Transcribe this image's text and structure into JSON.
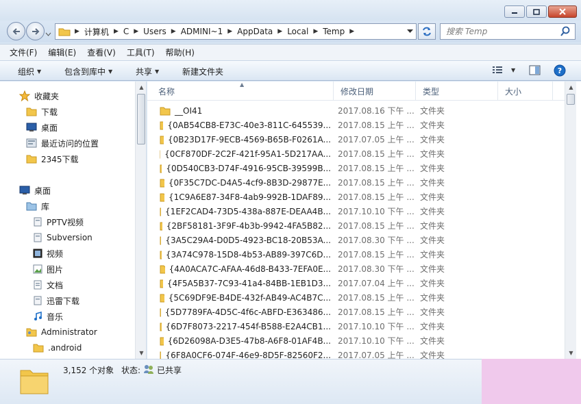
{
  "window": {
    "buttons": [
      "minimize",
      "maximize",
      "close"
    ]
  },
  "address_bar": {
    "crumbs": [
      "计算机",
      "C",
      "Users",
      "ADMINI~1",
      "AppData",
      "Local",
      "Temp"
    ]
  },
  "search": {
    "placeholder": "搜索 Temp"
  },
  "menu": [
    "文件(F)",
    "编辑(E)",
    "查看(V)",
    "工具(T)",
    "帮助(H)"
  ],
  "toolbar": {
    "organize": "组织",
    "include_library": "包含到库中",
    "share": "共享",
    "new_folder": "新建文件夹"
  },
  "nav": {
    "favorites": "收藏夹",
    "fav_items": [
      "下载",
      "桌面",
      "最近访问的位置",
      "2345下载"
    ],
    "desktop": "桌面",
    "library": "库",
    "lib_items": [
      "PPTV视频",
      "Subversion",
      "视频",
      "图片",
      "文档",
      "迅雷下载",
      "音乐"
    ],
    "administrator": "Administrator",
    "android": ".android"
  },
  "columns": {
    "name": "名称",
    "date": "修改日期",
    "type": "类型",
    "size": "大小"
  },
  "files": [
    {
      "name": "__OI41",
      "date": "2017.08.16 下午 ...",
      "type": "文件夹"
    },
    {
      "name": "{0AB54CB8-E73C-40e3-811C-645539...",
      "date": "2017.08.15 上午 ...",
      "type": "文件夹"
    },
    {
      "name": "{0B23D17F-9ECB-4569-B65B-F0261A...",
      "date": "2017.07.05 上午 ...",
      "type": "文件夹"
    },
    {
      "name": "{0CF870DF-2C2F-421f-95A1-5D217AA...",
      "date": "2017.08.15 上午 ...",
      "type": "文件夹"
    },
    {
      "name": "{0D540CB3-D74F-4916-95CB-39599B...",
      "date": "2017.08.15 上午 ...",
      "type": "文件夹"
    },
    {
      "name": "{0F35C7DC-D4A5-4cf9-8B3D-29877E...",
      "date": "2017.08.15 上午 ...",
      "type": "文件夹"
    },
    {
      "name": "{1C9A6E87-34F8-4ab9-992B-1DAF89...",
      "date": "2017.08.15 上午 ...",
      "type": "文件夹"
    },
    {
      "name": "{1EF2CAD4-73D5-438a-887E-DEAA4B...",
      "date": "2017.10.10 下午 ...",
      "type": "文件夹"
    },
    {
      "name": "{2BF58181-3F9F-4b3b-9942-4FA5B82...",
      "date": "2017.08.15 上午 ...",
      "type": "文件夹"
    },
    {
      "name": "{3A5C29A4-D0D5-4923-BC18-20B53A...",
      "date": "2017.08.30 下午 ...",
      "type": "文件夹"
    },
    {
      "name": "{3A74C978-15D8-4b53-AB89-397C6D...",
      "date": "2017.08.15 上午 ...",
      "type": "文件夹"
    },
    {
      "name": "{4A0ACA7C-AFAA-46d8-B433-7EFA0E...",
      "date": "2017.08.30 下午 ...",
      "type": "文件夹"
    },
    {
      "name": "{4F5A5B37-7C93-41a4-84BB-1EB1D3...",
      "date": "2017.07.04 上午 ...",
      "type": "文件夹"
    },
    {
      "name": "{5C69DF9E-B4DE-432f-AB49-AC4B7C...",
      "date": "2017.08.15 上午 ...",
      "type": "文件夹"
    },
    {
      "name": "{5D7789FA-4D5C-4f6c-ABFD-E363486...",
      "date": "2017.08.15 上午 ...",
      "type": "文件夹"
    },
    {
      "name": "{6D7F8073-2217-454f-B588-E2A4CB1...",
      "date": "2017.10.10 下午 ...",
      "type": "文件夹"
    },
    {
      "name": "{6D26098A-D3E5-47b8-A6F8-01AF4B...",
      "date": "2017.10.10 下午 ...",
      "type": "文件夹"
    },
    {
      "name": "{6F8A0CF6-074F-46e9-8D5F-82560F2...",
      "date": "2017.07.05 上午 ...",
      "type": "文件夹"
    }
  ],
  "status": {
    "count": "3,152 个对象",
    "state_label": "状态:",
    "state_value": "已共享"
  },
  "colors": {
    "folder": "#f2c64b",
    "accent": "#1e6fc8"
  }
}
